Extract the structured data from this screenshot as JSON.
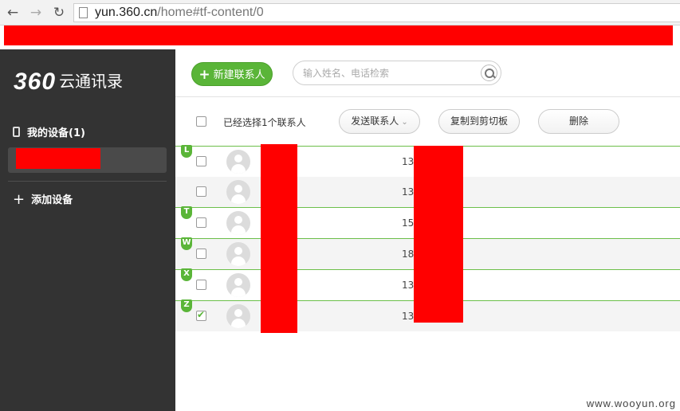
{
  "browser": {
    "back_icon": "arrow-left-icon",
    "forward_icon": "arrow-right-icon",
    "reload_icon": "reload-icon",
    "url_host": "yun.360.cn",
    "url_path": "/home#tf-content/0"
  },
  "sidebar": {
    "logo_num": "360",
    "logo_text": "云通讯录",
    "my_devices": "我的设备(1)",
    "add_device": "添加设备"
  },
  "toolbar": {
    "new_contact": "新建联系人",
    "search_placeholder": "输入姓名、电话检索",
    "selected_text": "已经选择1个联系人",
    "send_contact": "发送联系人",
    "copy_clipboard": "复制到剪切板",
    "delete": "删除"
  },
  "contacts": [
    {
      "letter": "L",
      "phone_prefix": "13",
      "checked": false
    },
    {
      "letter": "",
      "phone_prefix": "13",
      "checked": false
    },
    {
      "letter": "T",
      "phone_prefix": "15",
      "checked": false
    },
    {
      "letter": "W",
      "phone_prefix": "18",
      "checked": false
    },
    {
      "letter": "X",
      "phone_prefix": "13",
      "checked": false
    },
    {
      "letter": "Z",
      "phone_prefix": "13",
      "checked": true
    }
  ],
  "watermark": "www.wooyun.org",
  "colors": {
    "accent_green": "#5ab538",
    "sidebar_bg": "#333333",
    "redaction": "#ff0000"
  }
}
